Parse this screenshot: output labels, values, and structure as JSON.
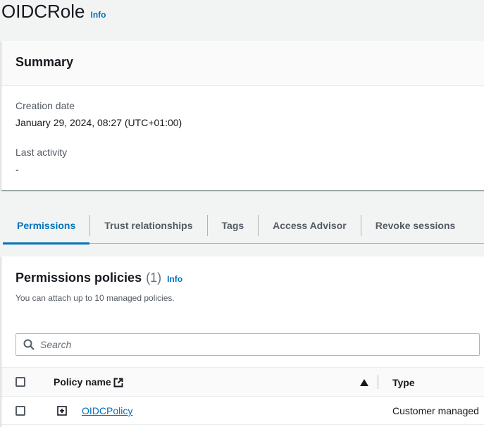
{
  "header": {
    "title": "OIDCRole",
    "info": "Info"
  },
  "summary": {
    "title": "Summary",
    "creation_label": "Creation date",
    "creation_value": "January 29, 2024, 08:27 (UTC+01:00)",
    "activity_label": "Last activity",
    "activity_value": "-"
  },
  "tabs": [
    {
      "label": "Permissions",
      "active": true
    },
    {
      "label": "Trust relationships"
    },
    {
      "label": "Tags"
    },
    {
      "label": "Access Advisor"
    },
    {
      "label": "Revoke sessions"
    }
  ],
  "policies": {
    "title": "Permissions policies",
    "count": "(1)",
    "info": "Info",
    "description": "You can attach up to 10 managed policies.",
    "search_placeholder": "Search",
    "columns": {
      "name": "Policy name",
      "type": "Type"
    },
    "rows": [
      {
        "name": "OIDCPolicy",
        "type": "Customer managed"
      }
    ]
  },
  "colors": {
    "accent": "#0073bb",
    "text": "#16191f",
    "muted": "#545b64",
    "background": "#f2f3f3"
  }
}
